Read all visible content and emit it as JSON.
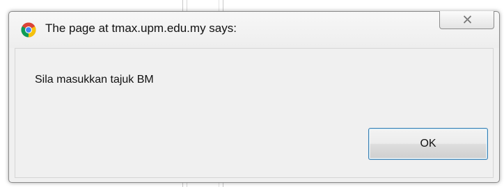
{
  "dialog": {
    "title": "The page at tmax.upm.edu.my says:",
    "message": "Sila masukkan tajuk BM",
    "ok_label": "OK",
    "icons": {
      "app": "chrome-icon",
      "close": "close-icon"
    }
  },
  "colors": {
    "dialog_bg": "#f0f0f0",
    "button_border": "#3c7fb1",
    "chrome_red": "#db4437",
    "chrome_yellow": "#f4c20d",
    "chrome_green": "#0f9d58",
    "chrome_blue": "#4285f4"
  }
}
